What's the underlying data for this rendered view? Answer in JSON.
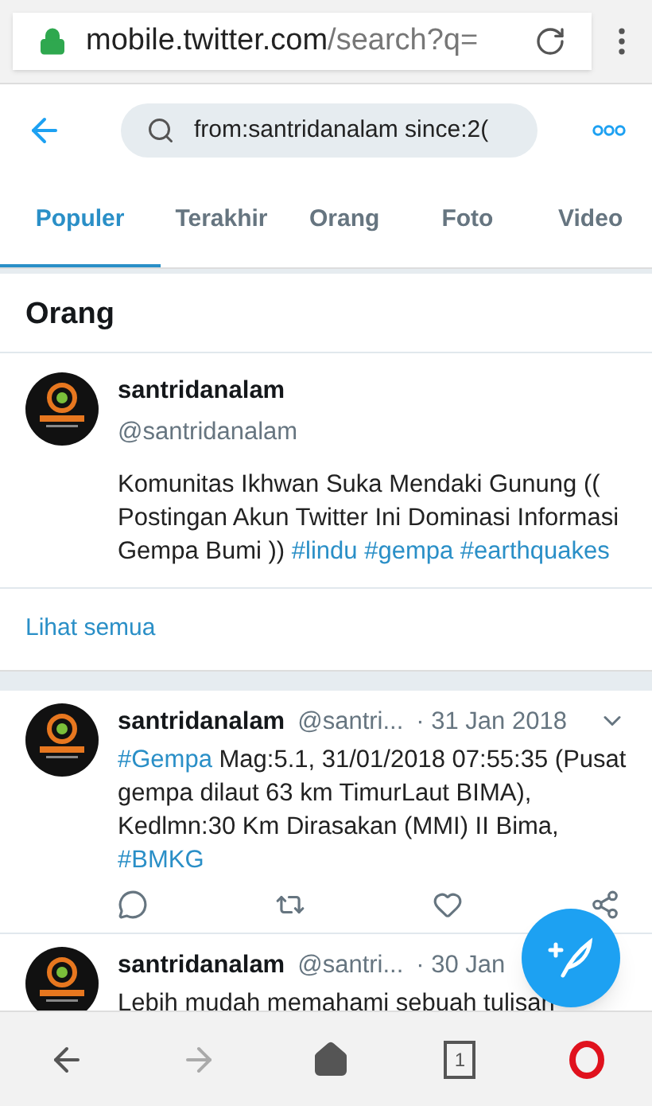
{
  "browser": {
    "url_host": "mobile.twitter.com",
    "url_path": "/search?q="
  },
  "search": {
    "value": "from:santridanalam since:2("
  },
  "tabs": [
    {
      "label": "Populer",
      "selected": true
    },
    {
      "label": "Terakhir",
      "selected": false
    },
    {
      "label": "Orang",
      "selected": false
    },
    {
      "label": "Foto",
      "selected": false
    },
    {
      "label": "Video",
      "selected": false
    }
  ],
  "people": {
    "title": "Orang",
    "users": [
      {
        "name": "santridanalam",
        "handle": "@santridanalam",
        "bio": [
          {
            "kind": "text",
            "text": "Komunitas Ikhwan Suka Mendaki Gunung (( Postingan Akun Twitter Ini Dominasi Informasi Gempa Bumi ))"
          },
          {
            "kind": "hashtag",
            "text": "#lindu"
          },
          {
            "kind": "hashtag",
            "text": "#gempa"
          },
          {
            "kind": "hashtag",
            "text": "#earthquakes"
          }
        ]
      }
    ],
    "see_all": "Lihat semua"
  },
  "tweets": [
    {
      "kind": "full",
      "name": "santridanalam",
      "handle": "@santri...",
      "date": "· 31 Jan 2018",
      "body": [
        {
          "kind": "hashtag",
          "text": "#Gempa"
        },
        {
          "kind": "text",
          "text": "Mag:5.1, 31/01/2018 07:55:35 (Pusat gempa dilaut 63 km TimurLaut BIMA), Kedlmn:30 Km Dirasakan (MMI) II Bima,"
        },
        {
          "kind": "hashtag",
          "text": "#BMKG"
        }
      ]
    },
    {
      "kind": "partial",
      "name": "santridanalam",
      "handle": "@santri...",
      "date": "· 30 Jan",
      "body": [
        {
          "kind": "text",
          "text": "Lebih mudah memahami sebuah tulisan"
        }
      ]
    }
  ],
  "bottom_nav": {
    "tab_count": "1"
  }
}
